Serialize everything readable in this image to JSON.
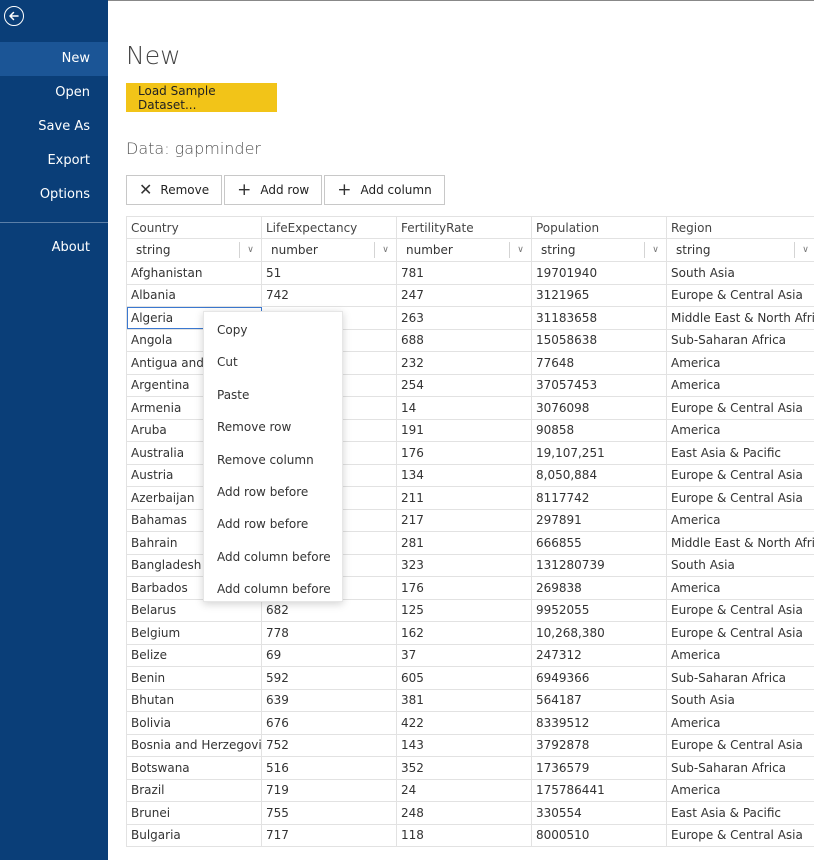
{
  "sidebar": {
    "back_icon": "arrow-left-circle-icon",
    "items": [
      {
        "label": "New",
        "active": true
      },
      {
        "label": "Open"
      },
      {
        "label": "Save As"
      },
      {
        "label": "Export"
      },
      {
        "label": "Options"
      }
    ],
    "about": "About"
  },
  "main": {
    "title": "New",
    "load_button": "Load Sample Dataset...",
    "data_label": "Data: gapminder"
  },
  "toolbar": {
    "remove": "Remove",
    "add_row": "Add row",
    "add_column": "Add column"
  },
  "table": {
    "headers": [
      "Country",
      "LifeExpectancy",
      "FertilityRate",
      "Population",
      "Region"
    ],
    "types": [
      "string",
      "number",
      "number",
      "string",
      "string"
    ],
    "rows": [
      [
        "Afghanistan",
        "51",
        "781",
        "19701940",
        "South Asia"
      ],
      [
        "Albania",
        "742",
        "247",
        "3121965",
        "Europe & Central Asia"
      ],
      [
        "Algeria",
        "",
        "263",
        "31183658",
        "Middle East & North Africa"
      ],
      [
        "Angola",
        "",
        "688",
        "15058638",
        "Sub-Saharan Africa"
      ],
      [
        "Antigua and Barbuda",
        "",
        "232",
        "77648",
        "America"
      ],
      [
        "Argentina",
        "",
        "254",
        "37057453",
        "America"
      ],
      [
        "Armenia",
        "",
        "14",
        "3076098",
        "Europe & Central Asia"
      ],
      [
        "Aruba",
        "",
        "191",
        "90858",
        "America"
      ],
      [
        "Australia",
        "",
        "176",
        "19,107,251",
        "East Asia & Pacific"
      ],
      [
        "Austria",
        "",
        "134",
        "8,050,884",
        "Europe & Central Asia"
      ],
      [
        "Azerbaijan",
        "",
        "211",
        "8117742",
        "Europe & Central Asia"
      ],
      [
        "Bahamas",
        "",
        "217",
        "297891",
        "America"
      ],
      [
        "Bahrain",
        "",
        "281",
        "666855",
        "Middle East & North Africa"
      ],
      [
        "Bangladesh",
        "",
        "323",
        "131280739",
        "South Asia"
      ],
      [
        "Barbados",
        "",
        "176",
        "269838",
        "America"
      ],
      [
        "Belarus",
        "682",
        "125",
        "9952055",
        "Europe & Central Asia"
      ],
      [
        "Belgium",
        "778",
        "162",
        "10,268,380",
        "Europe & Central Asia"
      ],
      [
        "Belize",
        "69",
        "37",
        "247312",
        "America"
      ],
      [
        "Benin",
        "592",
        "605",
        "6949366",
        "Sub-Saharan Africa"
      ],
      [
        "Bhutan",
        "639",
        "381",
        "564187",
        "South Asia"
      ],
      [
        "Bolivia",
        "676",
        "422",
        "8339512",
        "America"
      ],
      [
        "Bosnia and Herzegovina",
        "752",
        "143",
        "3792878",
        "Europe & Central Asia"
      ],
      [
        "Botswana",
        "516",
        "352",
        "1736579",
        "Sub-Saharan Africa"
      ],
      [
        "Brazil",
        "719",
        "24",
        "175786441",
        "America"
      ],
      [
        "Brunei",
        "755",
        "248",
        "330554",
        "East Asia & Pacific"
      ],
      [
        "Bulgaria",
        "717",
        "118",
        "8000510",
        "Europe & Central Asia"
      ]
    ]
  },
  "context_menu": [
    "Copy",
    "Cut",
    "Paste",
    "Remove row",
    "Remove column",
    "Add row before",
    "Add row before",
    "Add column before",
    "Add column before"
  ]
}
